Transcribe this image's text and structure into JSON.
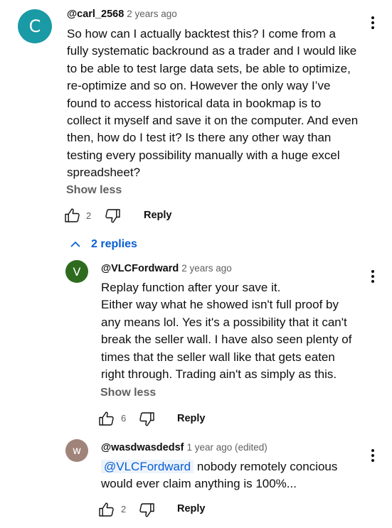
{
  "main_comment": {
    "avatar_letter": "C",
    "avatar_color": "#1a9aa5",
    "handle": "@carl_2568",
    "time": "2 years ago",
    "text_lines": [
      "So how can I actually backtest this? I come from a",
      "fully systematic backround as a trader and I would like",
      "to be able to test large data sets, be able to optimize,",
      "re-optimize and so on. However the only way I’ve",
      "found to access historical data in bookmap is to",
      "collect it myself and save it on the computer. And even",
      "then, how do I test it? Is there any other way than",
      "testing every possibility manually with a huge excel",
      "spreadsheet?"
    ],
    "show_less": "Show less",
    "likes": "2",
    "reply_label": "Reply"
  },
  "replies_toggle": {
    "label": "2 replies",
    "accent": "#065fd4"
  },
  "reply_1": {
    "avatar_letter": "V",
    "avatar_color": "#2e6b1f",
    "handle": "@VLCFordward",
    "time": "2 years ago",
    "text_lines": [
      "Replay function after your save it.",
      "Either way what he showed isn't full proof by",
      "any means lol. Yes it's a possibility that it can't",
      "break the seller wall. I have also seen plenty of",
      "times that the seller wall like that gets eaten",
      "right through. Trading ain't as simply as this."
    ],
    "show_less": "Show less",
    "likes": "6",
    "reply_label": "Reply"
  },
  "reply_2": {
    "avatar_letter": "w",
    "avatar_color": "#a0847a",
    "handle": "@wasdwasdedsf",
    "time": "1 year ago (edited)",
    "mention": "@VLCFordward",
    "text_line1_rest": "nobody remotely concious",
    "text_line2": "would ever claim anything is 100%...",
    "likes": "2",
    "reply_label": "Reply"
  }
}
